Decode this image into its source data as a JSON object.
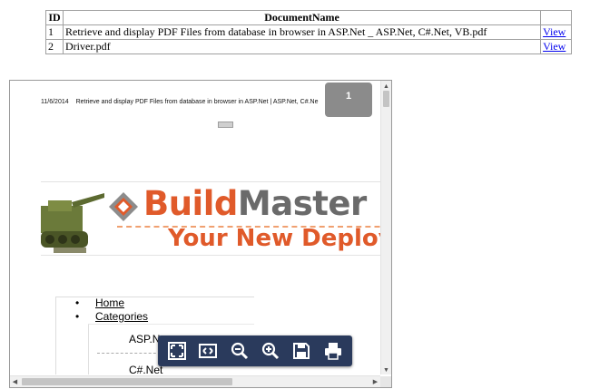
{
  "table": {
    "headers": {
      "id": "ID",
      "name": "DocumentName"
    },
    "rows": [
      {
        "id": "1",
        "name": "Retrieve and display PDF Files from database in browser in ASP.Net _ ASP.Net, C#.Net, VB.pdf",
        "action": "View"
      },
      {
        "id": "2",
        "name": "Driver.pdf",
        "action": "View"
      }
    ]
  },
  "viewer": {
    "header_date": "11/6/2014",
    "header_title": "Retrieve and display PDF Files from database in browser in ASP.Net | ASP.Net, C#.Ne",
    "page_number": "1",
    "banner": {
      "brand_part1": "Build",
      "brand_part2": "Master",
      "tagline": "Your New Deploy",
      "colors": {
        "orange": "#e05a2a",
        "gray": "#6a6a6a"
      }
    },
    "nav": {
      "items": [
        "Home",
        "Categories"
      ],
      "subitems": [
        "ASP.Net",
        "C#.Net"
      ]
    },
    "toolbar": {
      "icons": [
        "fit-page-icon",
        "fit-width-icon",
        "zoom-out-icon",
        "zoom-in-icon",
        "save-icon",
        "print-icon"
      ],
      "background": "#2a3a5c"
    }
  }
}
